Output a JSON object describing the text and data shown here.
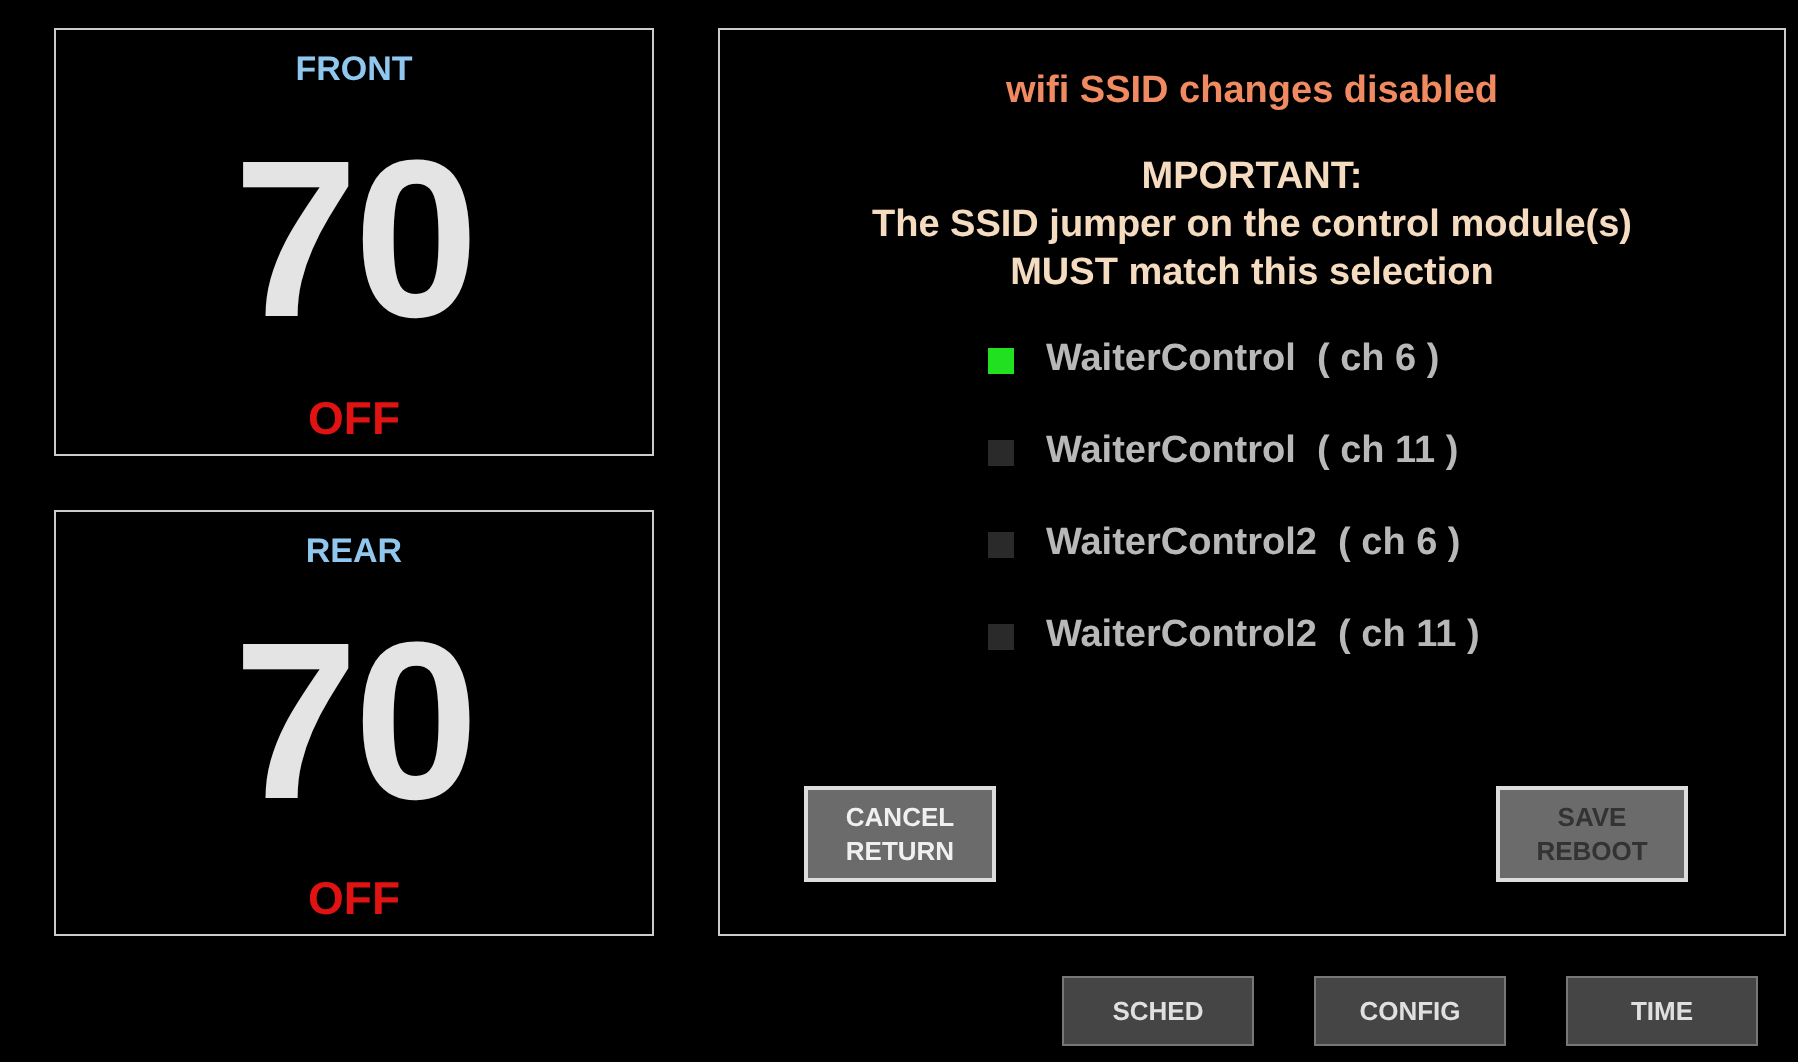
{
  "zones": [
    {
      "name": "FRONT",
      "temperature": "70",
      "status": "OFF"
    },
    {
      "name": "REAR",
      "temperature": "70",
      "status": "OFF"
    }
  ],
  "wifi_panel": {
    "notice": "wifi SSID changes disabled",
    "warning_title": "MPORTANT:",
    "warning_lines": [
      "The SSID jumper on the control module(s)",
      "MUST match this selection"
    ],
    "options": [
      {
        "label": "WaiterControl  ( ch 6 )",
        "selected": true
      },
      {
        "label": "WaiterControl  ( ch 11 )",
        "selected": false
      },
      {
        "label": "WaiterControl2  ( ch 6 )",
        "selected": false
      },
      {
        "label": "WaiterControl2  ( ch 11 )",
        "selected": false
      }
    ],
    "buttons": [
      {
        "label": "CANCEL\nRETURN",
        "disabled": false
      },
      {
        "label": "SAVE\nREBOOT",
        "disabled": true
      }
    ]
  },
  "nav_buttons": [
    "SCHED",
    "CONFIG",
    "TIME"
  ]
}
